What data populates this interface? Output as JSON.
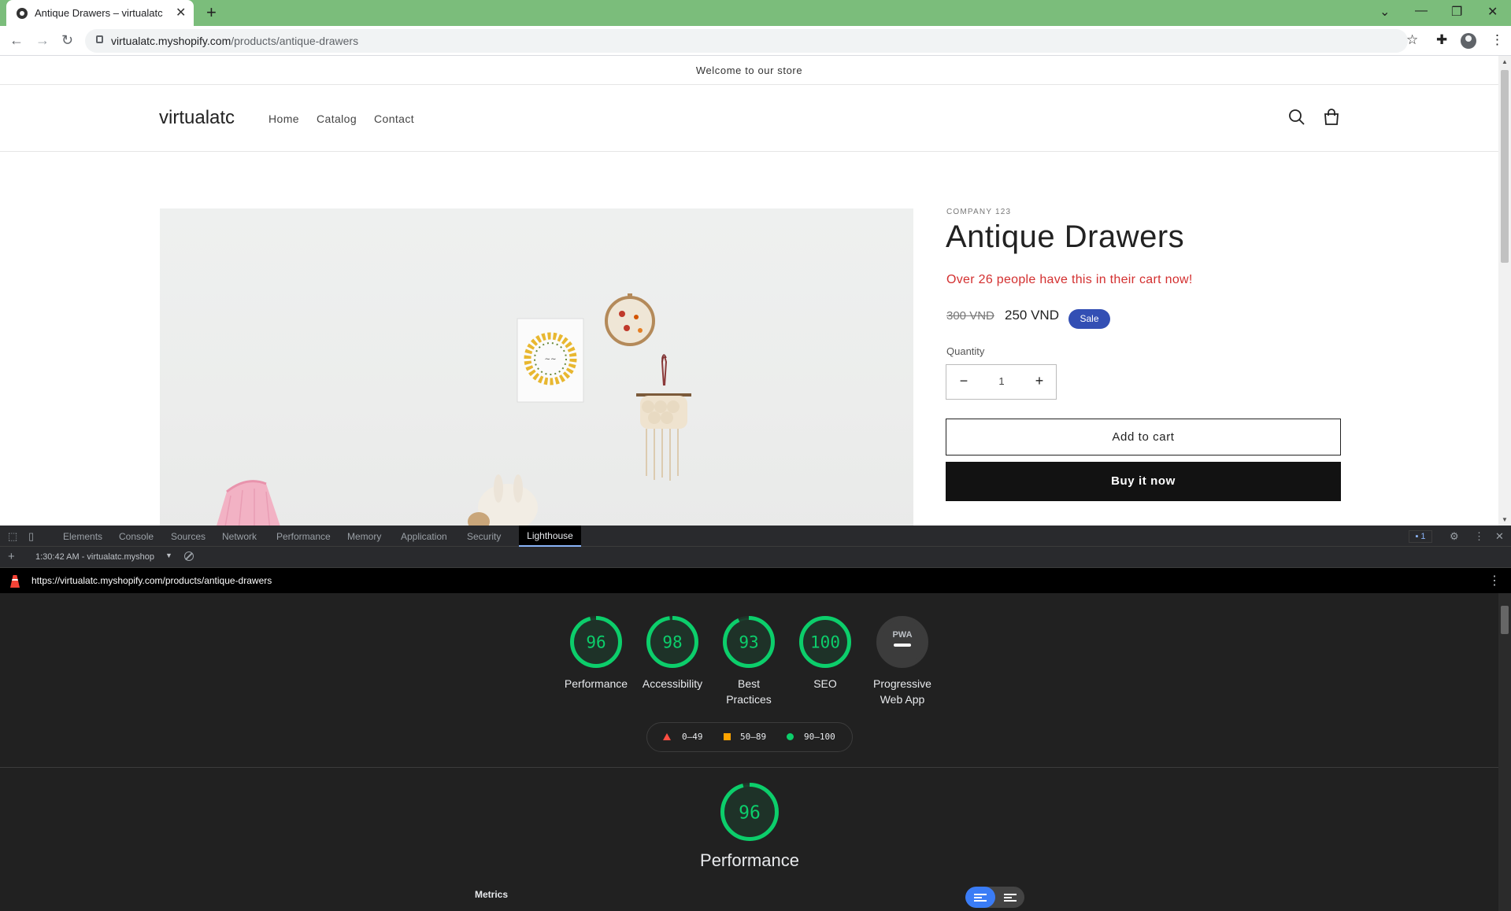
{
  "browser": {
    "tab_title": "Antique Drawers – virtualatc",
    "url_host": "virtualatc.myshopify.com",
    "url_path": "/products/antique-drawers",
    "new_tab": "+",
    "close": "✕"
  },
  "store": {
    "announcement": "Welcome to our store",
    "logo": "virtualatc",
    "nav": [
      "Home",
      "Catalog",
      "Contact"
    ],
    "product": {
      "vendor": "COMPANY 123",
      "title": "Antique Drawers",
      "urgency": "Over 26 people have this in their cart now!",
      "price_old": "300 VND",
      "price_new": "250 VND",
      "badge": "Sale",
      "quantity_label": "Quantity",
      "quantity": "1",
      "minus": "−",
      "plus": "+",
      "add_to_cart": "Add to cart",
      "buy_now": "Buy it now"
    }
  },
  "devtools": {
    "tabs": [
      "Elements",
      "Console",
      "Sources",
      "Network",
      "Performance",
      "Memory",
      "Application",
      "Security",
      "Lighthouse"
    ],
    "issues_count": "1",
    "report_label": "1:30:42 AM - virtualatc.myshop",
    "lighthouse_url": "https://virtualatc.myshopify.com/products/antique-drawers",
    "gauges": [
      {
        "score": "96",
        "label": "Performance",
        "value": 0.96
      },
      {
        "score": "98",
        "label": "Accessibility",
        "value": 0.98
      },
      {
        "score": "93",
        "label": "Best Practices",
        "value": 0.93
      },
      {
        "score": "100",
        "label": "SEO",
        "value": 1.0
      },
      {
        "score": "PWA",
        "label": "Progressive Web App",
        "value": 0
      }
    ],
    "legend": [
      "0–49",
      "50–89",
      "90–100"
    ],
    "performance": {
      "score": "96",
      "value": 0.96,
      "title": "Performance"
    },
    "metrics_label": "Metrics",
    "colors": {
      "pass": "#0cce6b",
      "average": "#ffa400",
      "fail": "#ff4e42"
    }
  }
}
